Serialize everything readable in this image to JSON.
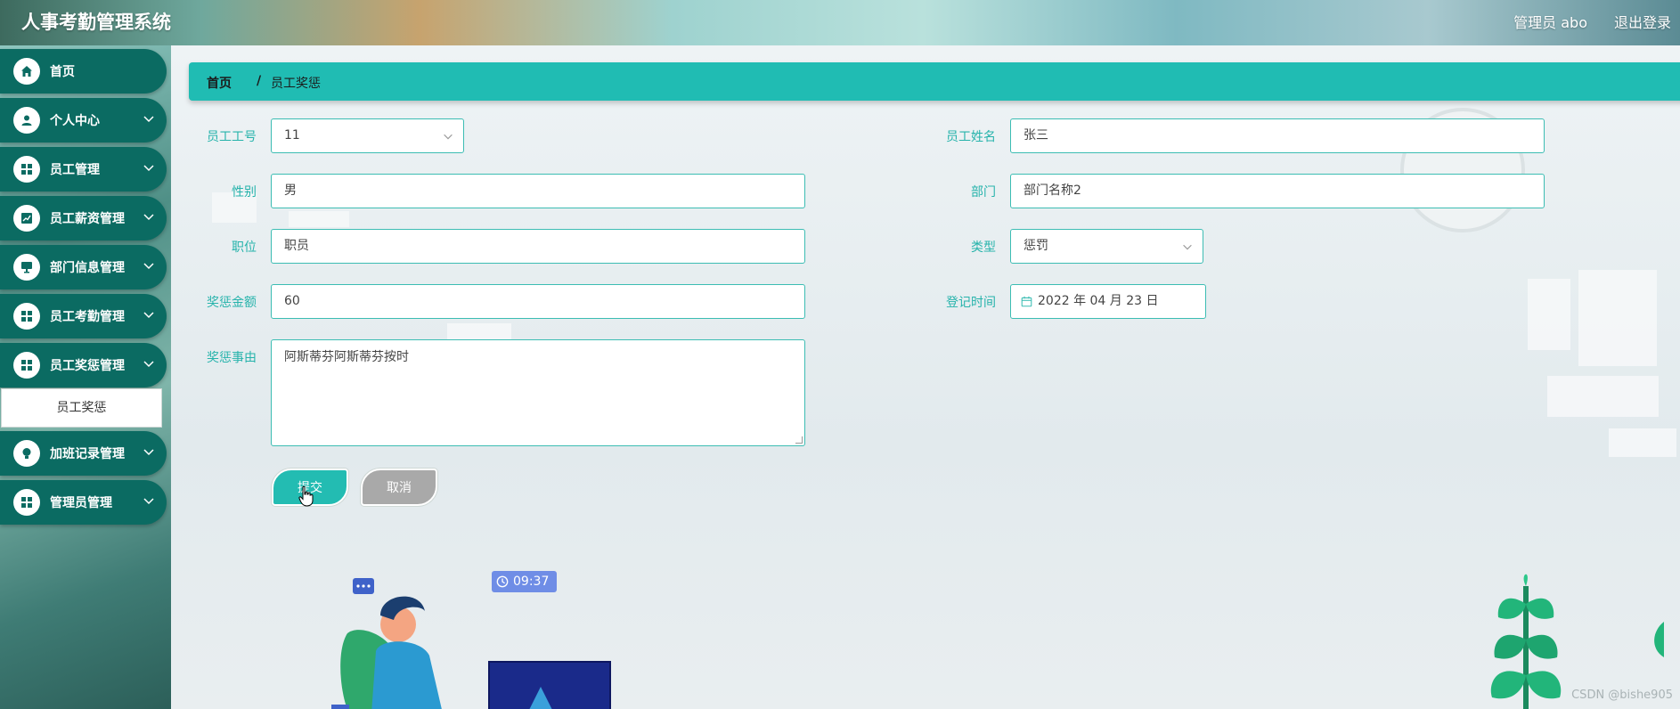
{
  "app": {
    "title": "人事考勤管理系统",
    "user": "管理员 abo",
    "logout": "退出登录"
  },
  "sidebar": {
    "items": [
      {
        "label": "首页",
        "icon": "home-icon"
      },
      {
        "label": "个人中心",
        "icon": "person-icon"
      },
      {
        "label": "员工管理",
        "icon": "grid-icon"
      },
      {
        "label": "员工薪资管理",
        "icon": "chart-icon"
      },
      {
        "label": "部门信息管理",
        "icon": "monitor-icon"
      },
      {
        "label": "员工考勤管理",
        "icon": "grid-icon"
      },
      {
        "label": "员工奖惩管理",
        "icon": "grid-icon"
      },
      {
        "label": "加班记录管理",
        "icon": "bulb-icon"
      },
      {
        "label": "管理员管理",
        "icon": "grid-icon"
      }
    ],
    "active_sub": "员工奖惩"
  },
  "breadcrumb": {
    "home": "首页",
    "separator": "/",
    "current": "员工奖惩"
  },
  "form": {
    "emp_no_label": "员工工号",
    "emp_no_value": "11",
    "emp_name_label": "员工姓名",
    "emp_name_value": "张三",
    "gender_label": "性别",
    "gender_value": "男",
    "dept_label": "部门",
    "dept_value": "部门名称2",
    "position_label": "职位",
    "position_value": "职员",
    "type_label": "类型",
    "type_value": "惩罚",
    "amount_label": "奖惩金额",
    "amount_value": "60",
    "date_label": "登记时间",
    "date_value": "2022 年 04 月 23 日",
    "reason_label": "奖惩事由",
    "reason_value": "阿斯蒂芬阿斯蒂芬按时",
    "submit": "提交",
    "cancel": "取消"
  },
  "decor": {
    "clock_time": "09:37",
    "watermark": "CSDN @bishe905"
  },
  "colors": {
    "accent": "#20bcb3",
    "sidebar_item": "#0b6b62",
    "label": "#26b3ab",
    "cancel": "#a9a9a9"
  }
}
